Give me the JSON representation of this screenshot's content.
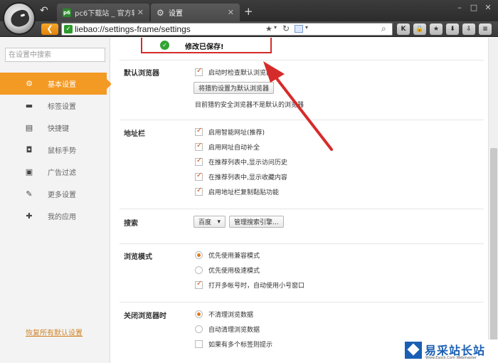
{
  "browser": {
    "tabs": [
      {
        "title": "pc6下载站 _ 官方软...",
        "favicon": "pc6",
        "active": false
      },
      {
        "title": "设置",
        "favicon": "gear-icon",
        "active": true
      }
    ],
    "new_tab": "+",
    "window_controls": [
      "–",
      "□",
      "✕"
    ],
    "address_bar": {
      "url": "liebao://settings-frame/settings"
    },
    "toolbar_buttons": [
      "K",
      "🔒",
      "★",
      "⬇",
      "⇩",
      "≡"
    ]
  },
  "sidebar": {
    "search_placeholder": "在设置中搜索",
    "items": [
      {
        "label": "基本设置",
        "icon": "gear-icon",
        "active": true
      },
      {
        "label": "标签设置",
        "icon": "laptop-icon",
        "active": false
      },
      {
        "label": "快捷键",
        "icon": "keyboard-icon",
        "active": false
      },
      {
        "label": "鼠标手势",
        "icon": "mouse-icon",
        "active": false
      },
      {
        "label": "广告过滤",
        "icon": "window-icon",
        "active": false
      },
      {
        "label": "更多设置",
        "icon": "wrench-icon",
        "active": false
      },
      {
        "label": "我的应用",
        "icon": "puzzle-icon",
        "active": false
      }
    ],
    "restore_link": "恢复所有默认设置"
  },
  "notification": {
    "text": "修改已保存!"
  },
  "sections": {
    "default_browser": {
      "label": "默认浏览器",
      "option": "启动时检查默认浏览器",
      "button": "将猎豹设置为默认浏览器",
      "note": "目前猎豹安全浏览器不是默认的浏览器"
    },
    "address_bar": {
      "label": "地址栏",
      "options": [
        "启用智能网址(推荐)",
        "启用网址自动补全",
        "在推荐列表中,显示访问历史",
        "在推荐列表中,显示收藏内容",
        "启用地址栏复制黏贴功能"
      ]
    },
    "search": {
      "label": "搜索",
      "engine": "百度",
      "manage_button": "管理搜索引擎..."
    },
    "browse_mode": {
      "label": "浏览模式",
      "options": [
        "优先使用兼容模式",
        "优先使用极速模式",
        "打开多帐号时，自动使用小号窗口"
      ]
    },
    "close_browser": {
      "label": "关闭浏览器时",
      "options": [
        "不清理浏览数据",
        "自动清理浏览数据",
        "如果有多个标签则提示"
      ]
    }
  },
  "watermark": {
    "title": "易采站长站",
    "subtitle": "Www.Easck.Com Webmaster"
  },
  "colors": {
    "accent": "#f39a24",
    "highlight": "#d62b2b",
    "check": "#d05a1a"
  }
}
